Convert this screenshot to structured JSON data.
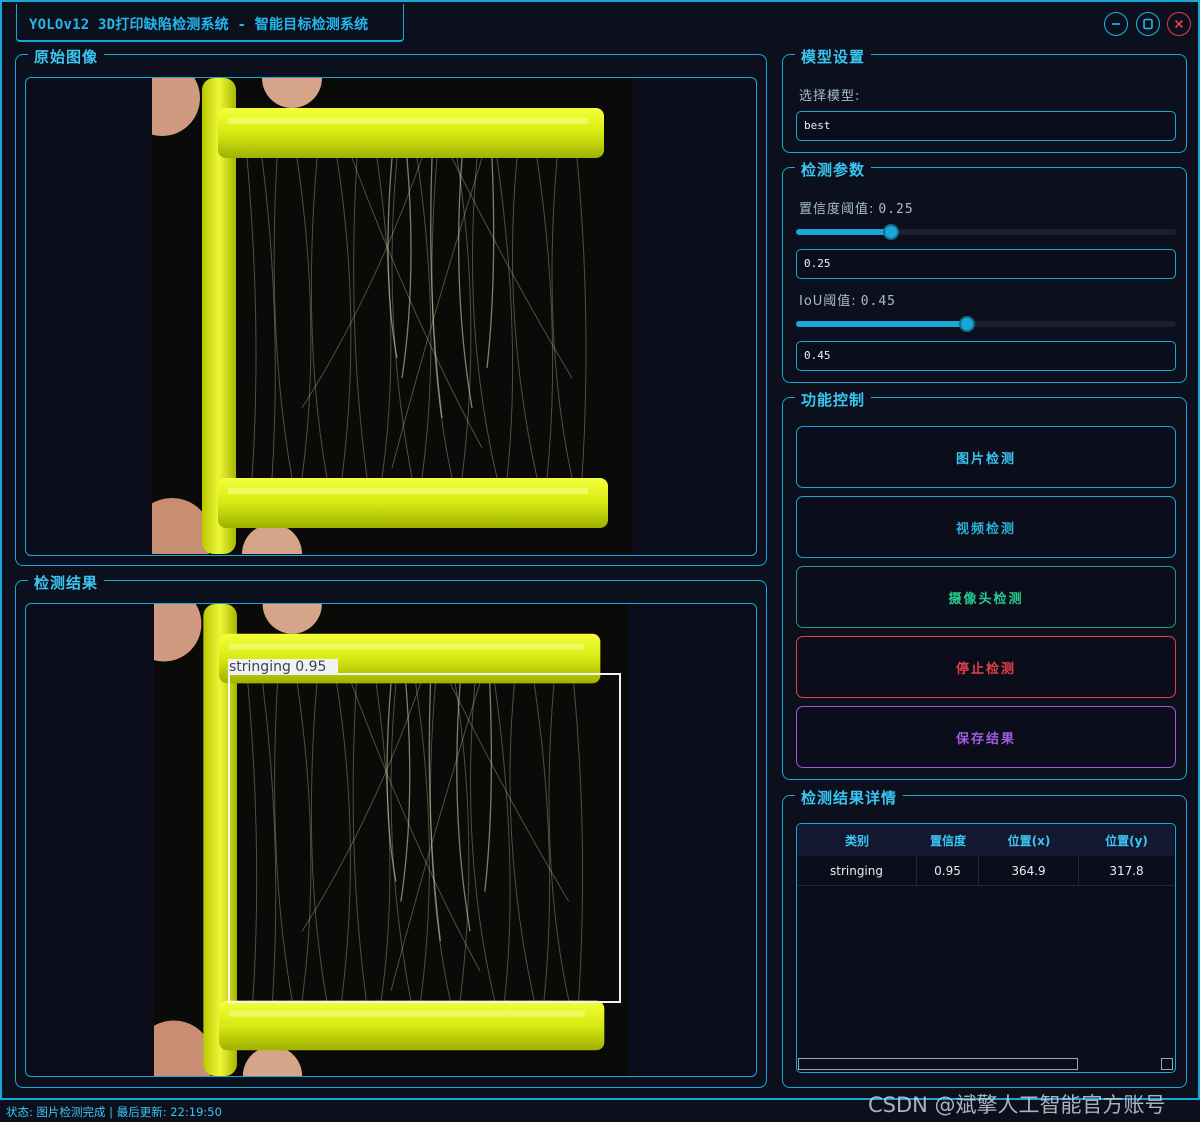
{
  "window": {
    "title": "YOLOv12 3D打印缺陷检测系统 - 智能目标检测系统"
  },
  "panels": {
    "original": {
      "title": "原始图像"
    },
    "result": {
      "title": "检测结果",
      "detections": [
        {
          "label": "stringing 0.95",
          "class": "stringing",
          "confidence": 0.95
        }
      ]
    }
  },
  "model_settings": {
    "title": "模型设置",
    "select_label": "选择模型:",
    "selected_model": "best"
  },
  "detection_params": {
    "title": "检测参数",
    "confidence": {
      "label": "置信度阈值:",
      "value": "0.25",
      "input_value": "0.25",
      "fraction": 0.25
    },
    "iou": {
      "label": "IoU阈值:",
      "value": "0.45",
      "input_value": "0.45",
      "fraction": 0.45
    }
  },
  "controls": {
    "title": "功能控制",
    "image_detect": "图片检测",
    "video_detect": "视频检测",
    "camera_detect": "摄像头检测",
    "stop_detect": "停止检测",
    "save_results": "保存结果"
  },
  "results_table": {
    "title": "检测结果详情",
    "columns": [
      "类别",
      "置信度",
      "位置(x)",
      "位置(y)"
    ],
    "rows": [
      [
        "stringing",
        "0.95",
        "364.9",
        "317.8"
      ]
    ]
  },
  "status_bar": {
    "text": "状态: 图片检测完成 | 最后更新: 22:19:50"
  },
  "watermark": "CSDN @斌擎人工智能官方账号",
  "colors": {
    "accent": "#1aa7d8",
    "background": "#0c0f1c",
    "camera": "#27c98f",
    "stop": "#e0404a",
    "save": "#a05ce0"
  }
}
